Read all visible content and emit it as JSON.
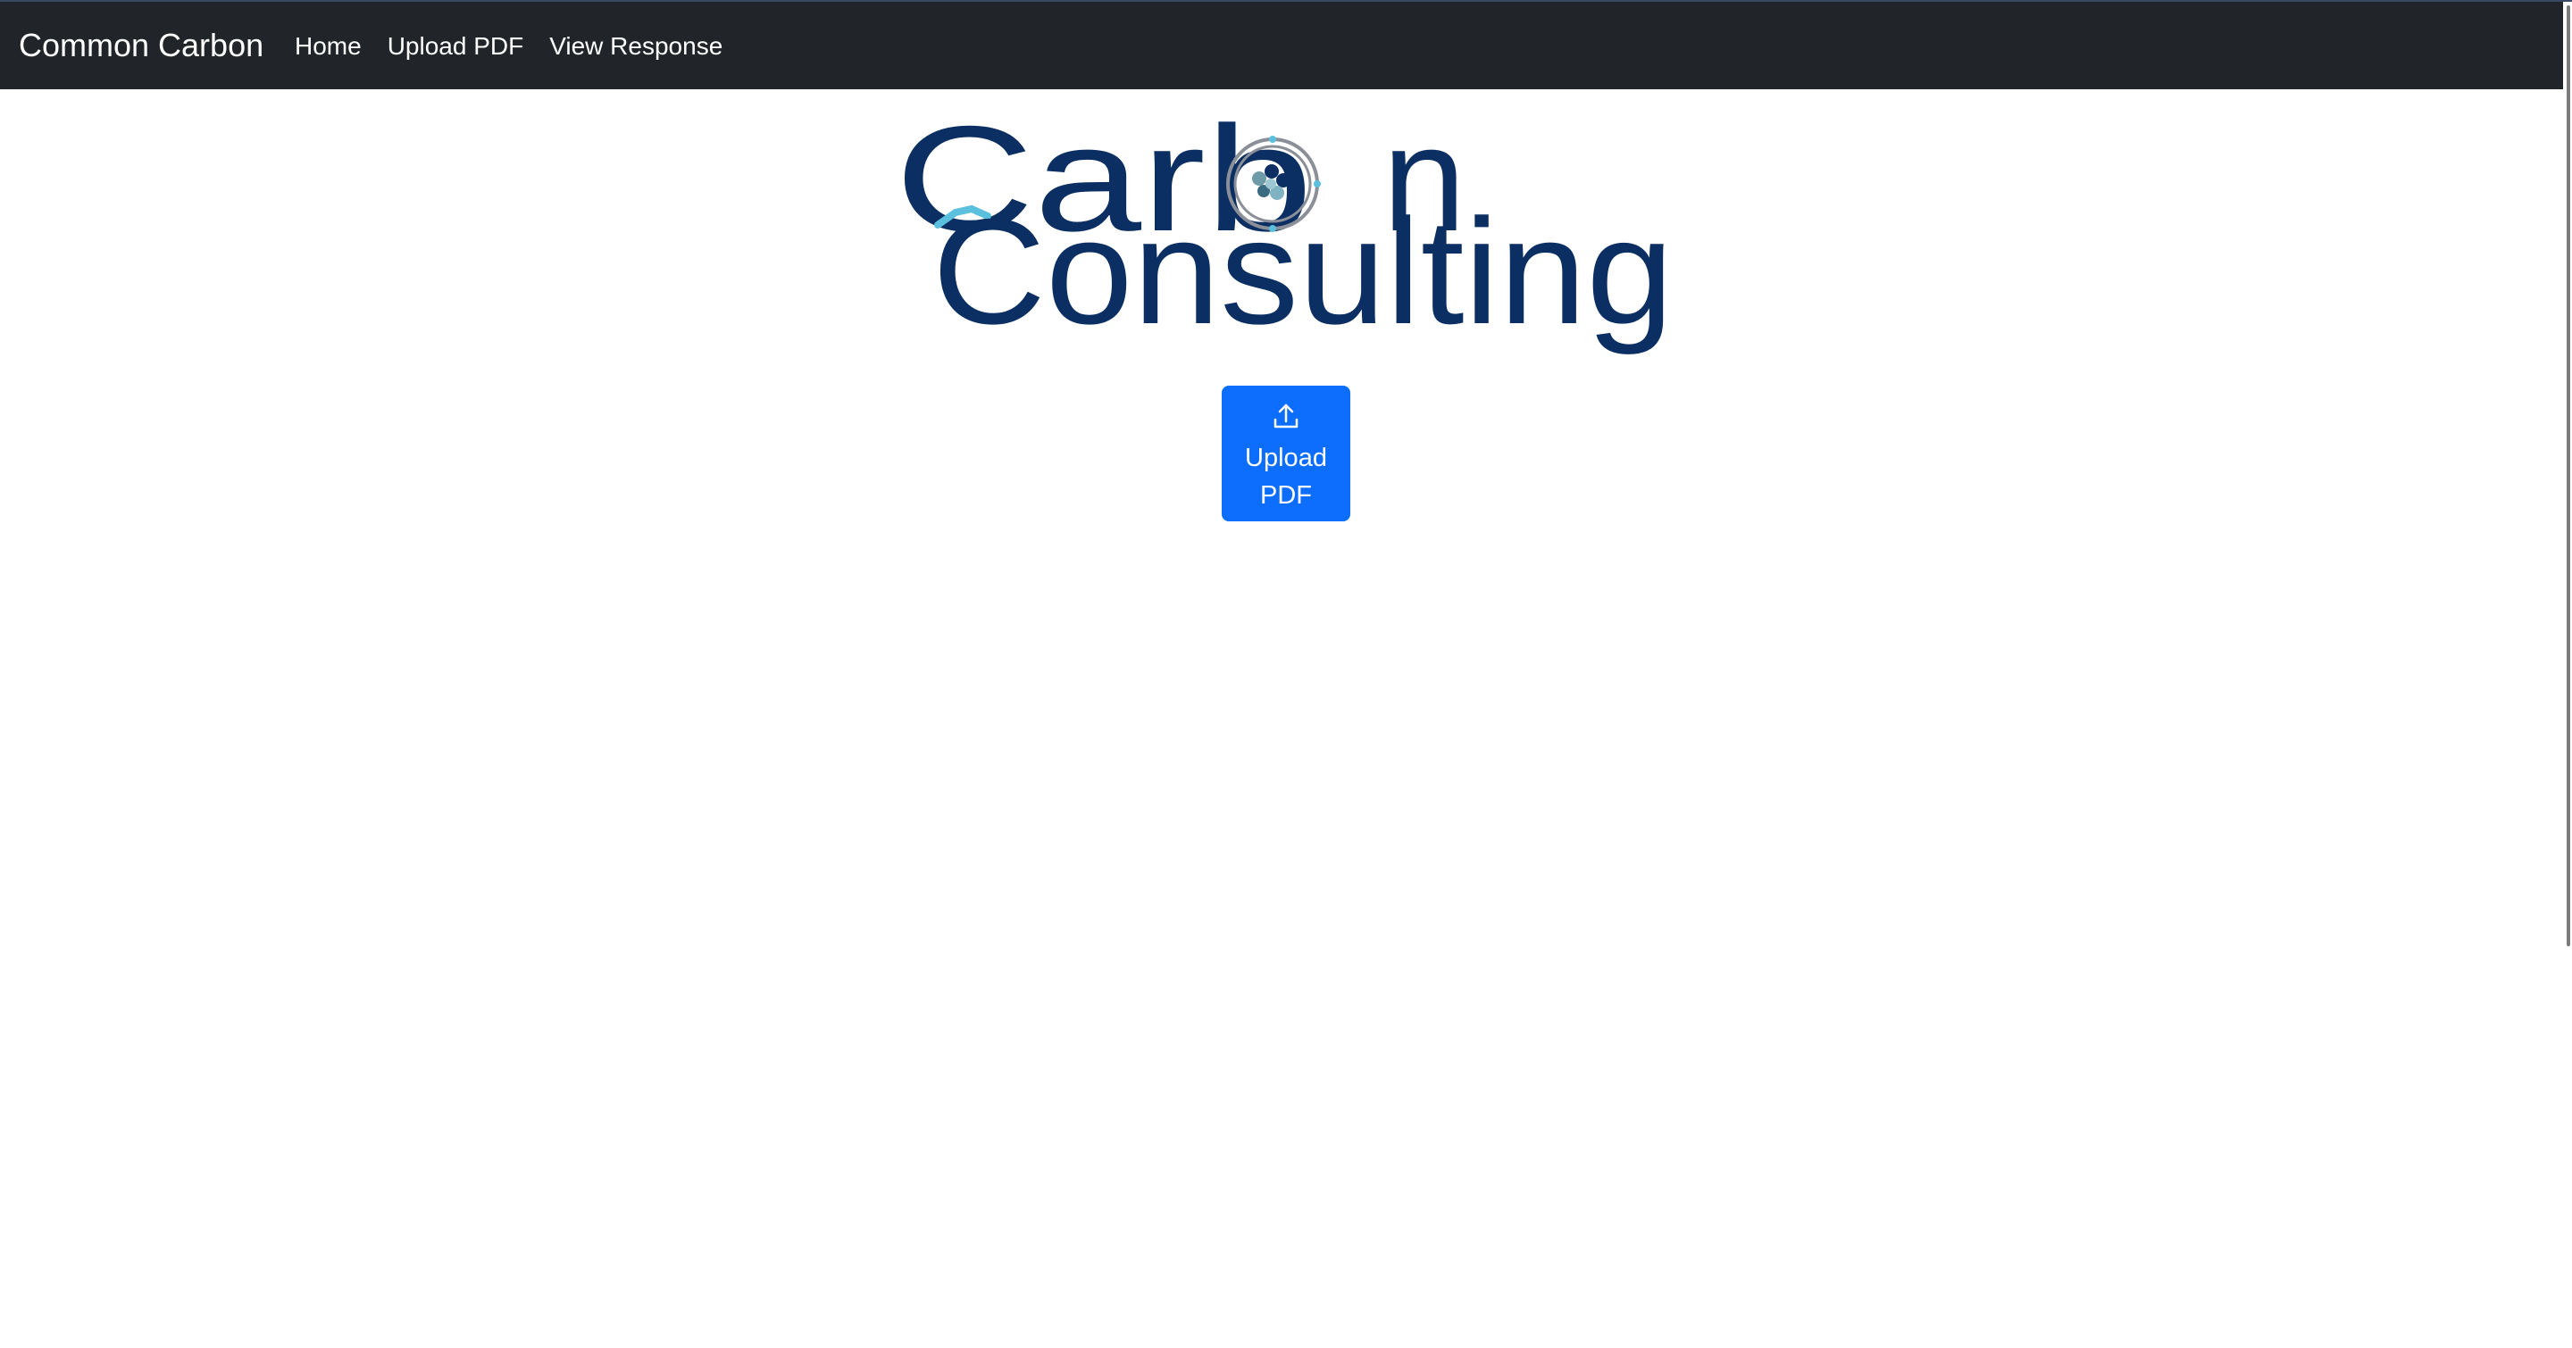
{
  "navbar": {
    "brand": "Common Carbon",
    "links": [
      "Home",
      "Upload PDF",
      "View Response"
    ],
    "background": "#212529"
  },
  "logo": {
    "line1": "Carb",
    "line1_end": "n",
    "line2": "Consulting",
    "color": "#0b2f63",
    "accent": "#5bc0de"
  },
  "upload_button": {
    "label": "Upload PDF",
    "icon": "upload-icon",
    "color": "#0d6efd"
  }
}
